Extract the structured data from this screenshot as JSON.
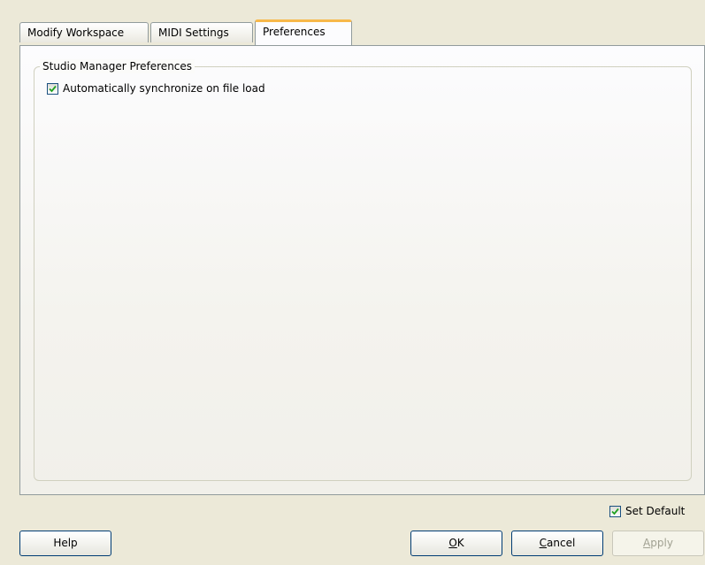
{
  "tabs": [
    {
      "label": "Modify Workspace"
    },
    {
      "label": "MIDI Settings"
    },
    {
      "label": "Preferences"
    }
  ],
  "active_tab": "Preferences",
  "group": {
    "title": "Studio Manager Preferences",
    "auto_sync": {
      "label": "Automatically synchronize on file load",
      "checked": true
    }
  },
  "set_default": {
    "label": "Set Default",
    "checked": true
  },
  "buttons": {
    "help": "Help",
    "ok": {
      "mnemonic": "O",
      "rest": "K"
    },
    "cancel": {
      "mnemonic": "C",
      "rest": "ancel"
    },
    "apply": {
      "mnemonic": "A",
      "rest": "pply",
      "enabled": false
    }
  },
  "colors": {
    "dialog_bg": "#ece9d8",
    "tab_highlight": "#f7b84a",
    "checkmark": "#21a121",
    "button_border": "#003c74"
  },
  "icons": {
    "checkmark": "checkmark-icon"
  }
}
